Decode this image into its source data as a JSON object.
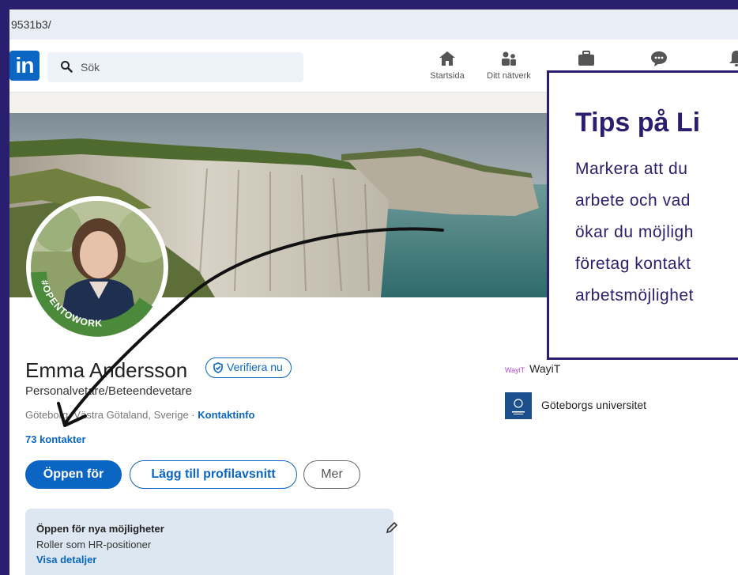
{
  "browser": {
    "url_fragment": "9531b3/"
  },
  "nav": {
    "search_placeholder": "Sök",
    "items": [
      {
        "label": "Startsida",
        "icon": "home-icon"
      },
      {
        "label": "Ditt nätverk",
        "icon": "network-icon"
      },
      {
        "label": "",
        "icon": "briefcase-icon"
      },
      {
        "label": "",
        "icon": "messaging-icon"
      },
      {
        "label": "",
        "icon": "bell-icon"
      }
    ]
  },
  "profile": {
    "name": "Emma Andersson",
    "verify_label": "Verifiera nu",
    "headline": "Personalvetare/Beteendevetare",
    "location": "Göteborg, Västra Götaland, Sverige · ",
    "contact_info": "Kontaktinfo",
    "connections": "73 kontakter",
    "open_to_badge": "#OPENTOWORK",
    "buttons": {
      "open_for": "Öppen för",
      "add_section": "Lägg till profilavsnitt",
      "more": "Mer"
    },
    "open_card": {
      "title": "Öppen för nya möjligheter",
      "roles": "Roller som HR-positioner",
      "details": "Visa detaljer"
    },
    "experience": [
      {
        "logo_text": "WayiT",
        "name": "WayiT"
      },
      {
        "logo_text": "",
        "name": "Göteborgs universitet"
      }
    ]
  },
  "tips": {
    "title": "Tips på Li",
    "lines": [
      "Markera att du",
      "arbete och vad",
      "ökar du möjligh",
      "företag kontakt",
      "arbetsmöjlighet"
    ]
  },
  "colors": {
    "linkedin_blue": "#0a66c2",
    "frame_purple": "#2a1f6e",
    "open_to_work_green": "#4b8a3a"
  }
}
